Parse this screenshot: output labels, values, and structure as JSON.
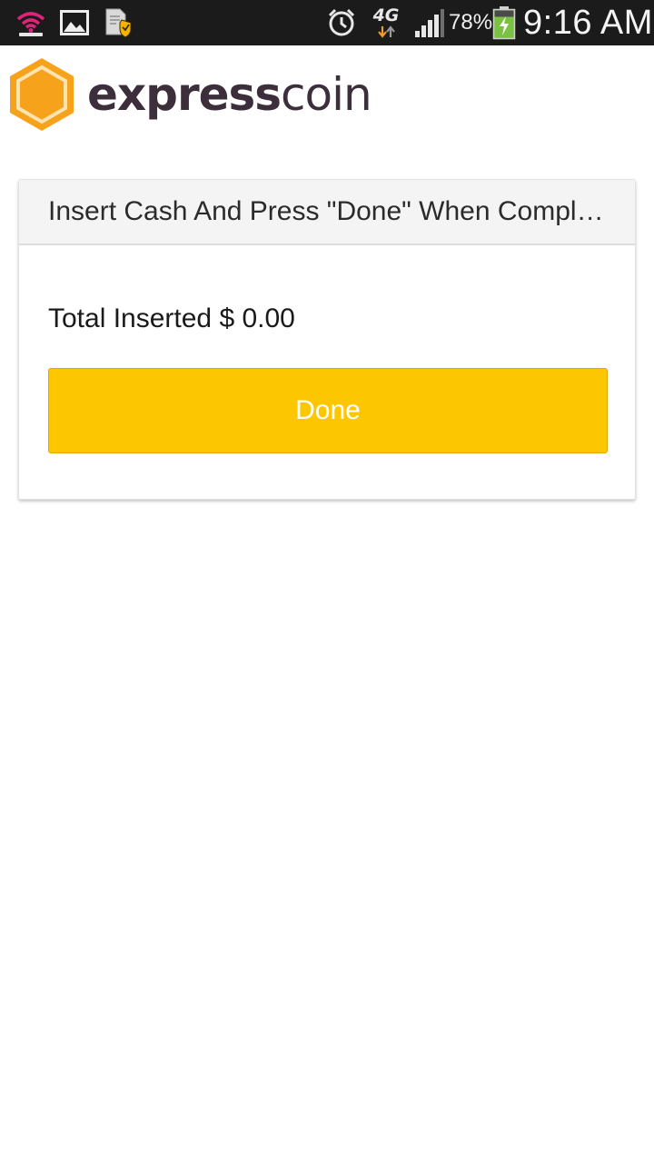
{
  "status_bar": {
    "network_type": "4G",
    "battery_percent": "78%",
    "time": "9:16 AM",
    "icons": [
      "wifi-hotspot-icon",
      "gallery-icon",
      "document-security-icon",
      "alarm-icon",
      "data-arrows-icon",
      "signal-icon",
      "battery-charging-icon"
    ],
    "colors": {
      "hotspot": "#e0237a",
      "battery": "#7cc242",
      "data_down": "#f29a2e"
    }
  },
  "brand": {
    "name_bold": "express",
    "name_light": "coin",
    "colors": {
      "hexagon": "#f7a21b",
      "text": "#3c2f3b"
    }
  },
  "card": {
    "title": "Insert Cash And Press \"Done\" When Completed",
    "total_label": "Total Inserted $",
    "total_value": "0.00",
    "done_label": "Done",
    "colors": {
      "button": "#fdc700"
    }
  }
}
